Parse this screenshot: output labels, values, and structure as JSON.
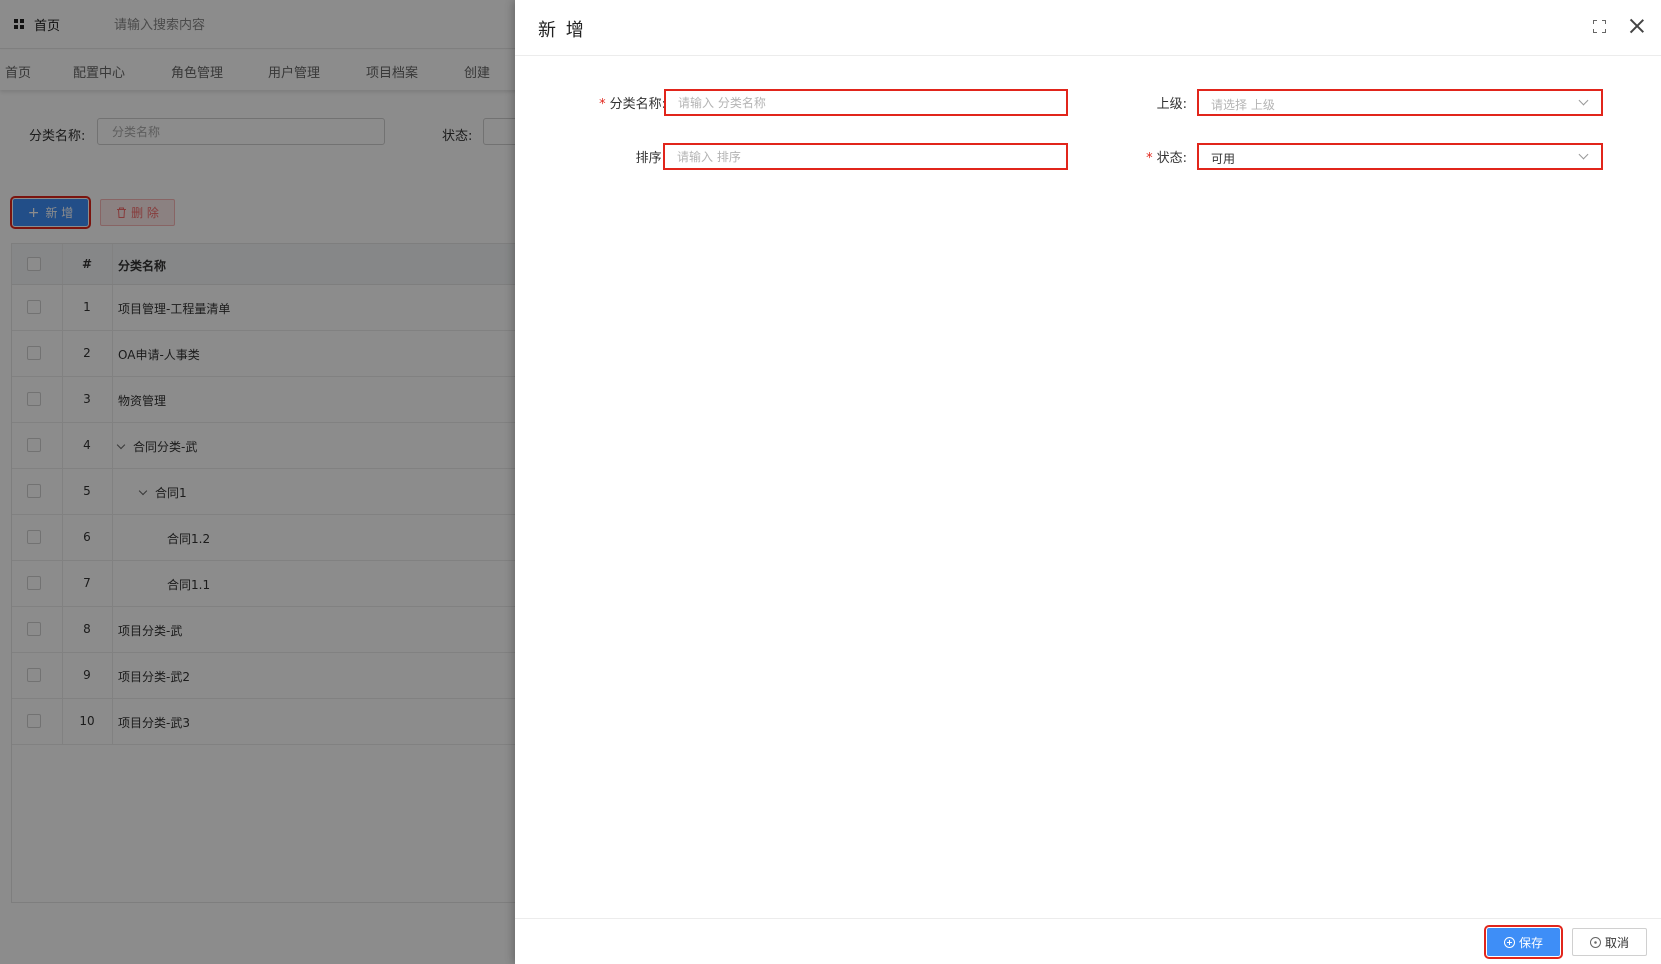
{
  "topbar": {
    "home_label": "首页",
    "search_placeholder": "请输入搜索内容"
  },
  "tabs": [
    {
      "label": "首页"
    },
    {
      "label": "配置中心"
    },
    {
      "label": "角色管理"
    },
    {
      "label": "用户管理"
    },
    {
      "label": "项目档案"
    },
    {
      "label": "创建"
    }
  ],
  "filter": {
    "name_label": "分类名称:",
    "name_placeholder": "分类名称",
    "status_label": "状态:"
  },
  "toolbar": {
    "add_label": "新 增",
    "delete_label": "删 除"
  },
  "table": {
    "col_index": "#",
    "col_name": "分类名称",
    "rows": [
      {
        "index": "1",
        "name": "项目管理-工程量清单",
        "level": 0,
        "expanded": false
      },
      {
        "index": "2",
        "name": "OA申请-人事类",
        "level": 0,
        "expanded": false
      },
      {
        "index": "3",
        "name": "物资管理",
        "level": 0,
        "expanded": false
      },
      {
        "index": "4",
        "name": "合同分类-武",
        "level": 0,
        "expanded": true
      },
      {
        "index": "5",
        "name": "合同1",
        "level": 1,
        "expanded": true
      },
      {
        "index": "6",
        "name": "合同1.2",
        "level": 2,
        "expanded": false
      },
      {
        "index": "7",
        "name": "合同1.1",
        "level": 2,
        "expanded": false
      },
      {
        "index": "8",
        "name": "项目分类-武",
        "level": 0,
        "expanded": false
      },
      {
        "index": "9",
        "name": "项目分类-武2",
        "level": 0,
        "expanded": false
      },
      {
        "index": "10",
        "name": "项目分类-武3",
        "level": 0,
        "expanded": false
      }
    ]
  },
  "dialog": {
    "title": "新 增",
    "fields": {
      "name": {
        "label": "分类名称:",
        "required": true,
        "placeholder": "请输入 分类名称",
        "value": ""
      },
      "parent": {
        "label": "上级:",
        "required": false,
        "placeholder": "请选择 上级",
        "value": ""
      },
      "sort": {
        "label": "排序:",
        "required": false,
        "placeholder": "请输入 排序",
        "value": ""
      },
      "status": {
        "label": "状态:",
        "required": true,
        "placeholder": "",
        "value": "可用"
      }
    },
    "save_label": "保存",
    "cancel_label": "取消"
  },
  "colors": {
    "primary": "#3e8ef7",
    "highlight": "#e1251b",
    "danger": "#f56c6c"
  },
  "icons": {
    "menu": "grid-icon",
    "add": "plus-icon",
    "delete": "trash-icon",
    "fullscreen": "fullscreen-icon",
    "close": "close-icon",
    "save": "plus-circle-icon",
    "cancel": "close-circle-icon"
  }
}
